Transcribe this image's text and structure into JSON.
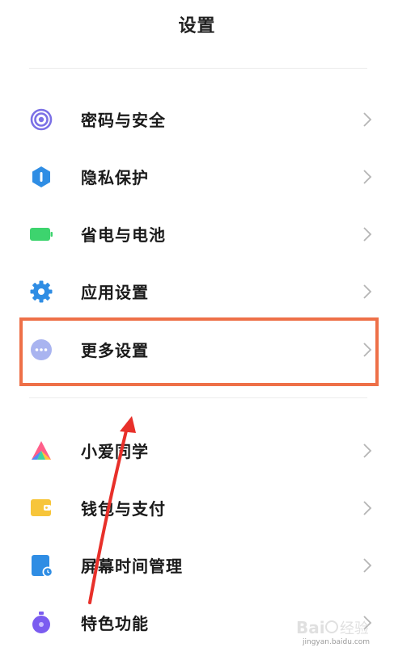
{
  "header": {
    "title": "设置"
  },
  "groups": [
    {
      "items": [
        {
          "label": "密码与安全",
          "icon": "fingerprint-icon",
          "color": "#7b70e6"
        },
        {
          "label": "隐私保护",
          "icon": "privacy-shield-icon",
          "color": "#2f8de4"
        },
        {
          "label": "省电与电池",
          "icon": "battery-icon",
          "color": "#3dd46e"
        },
        {
          "label": "应用设置",
          "icon": "gear-icon",
          "color": "#2f8de4"
        },
        {
          "label": "更多设置",
          "icon": "more-dots-icon",
          "color": "#a9b4f0"
        }
      ]
    },
    {
      "items": [
        {
          "label": "小爱同学",
          "icon": "xiaoai-icon",
          "color": "#ff5f8a"
        },
        {
          "label": "钱包与支付",
          "icon": "wallet-icon",
          "color": "#f7c53a"
        },
        {
          "label": "屏幕时间管理",
          "icon": "screen-time-icon",
          "color": "#2f8de4"
        },
        {
          "label": "特色功能",
          "icon": "special-features-icon",
          "color": "#7b5cf0"
        }
      ]
    }
  ],
  "annotation": {
    "highlight_color": "#ee7048",
    "arrow_color": "#e8302a"
  },
  "watermark": {
    "text": "jingyan.baidu.com"
  }
}
